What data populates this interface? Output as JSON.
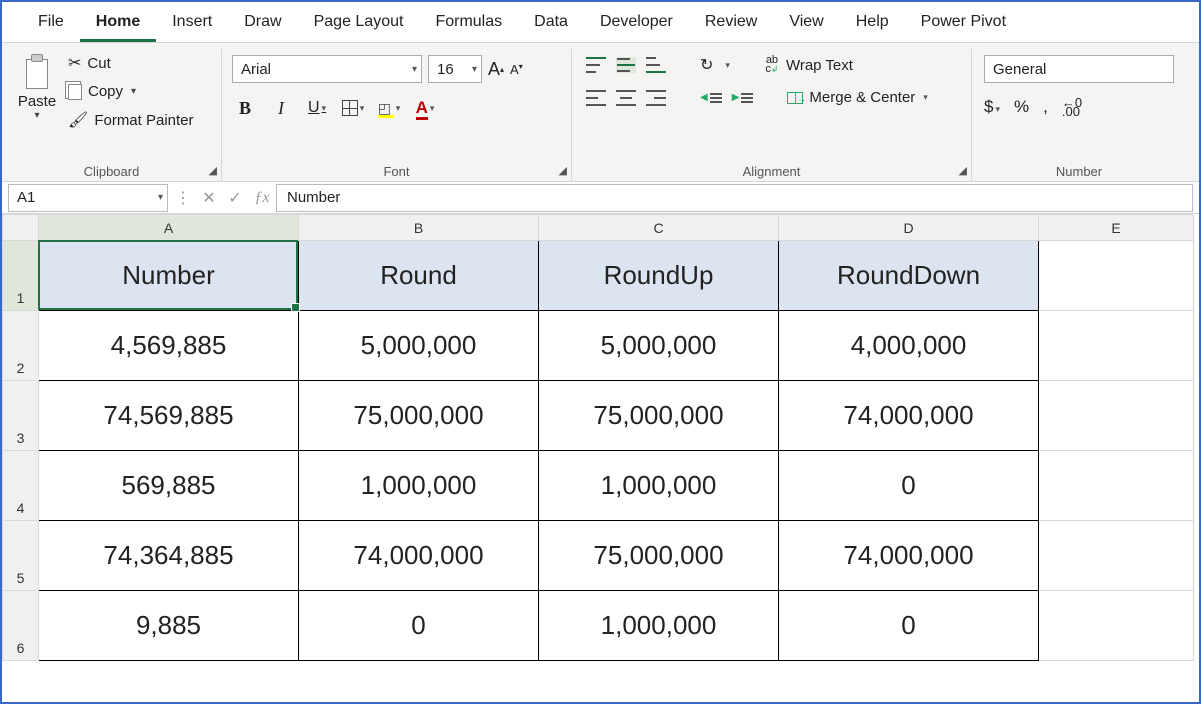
{
  "tabs": [
    "File",
    "Home",
    "Insert",
    "Draw",
    "Page Layout",
    "Formulas",
    "Data",
    "Developer",
    "Review",
    "View",
    "Help",
    "Power Pivot"
  ],
  "active_tab": "Home",
  "ribbon": {
    "clipboard": {
      "group_label": "Clipboard",
      "paste": "Paste",
      "cut": "Cut",
      "copy": "Copy",
      "format_painter": "Format Painter"
    },
    "font": {
      "group_label": "Font",
      "font_name": "Arial",
      "font_size": "16"
    },
    "alignment": {
      "group_label": "Alignment",
      "wrap_text": "Wrap Text",
      "merge_center": "Merge & Center"
    },
    "number": {
      "group_label": "Number",
      "format": "General"
    }
  },
  "namebox": "A1",
  "formula": "Number",
  "columns": [
    "A",
    "B",
    "C",
    "D",
    "E"
  ],
  "chart_data": {
    "type": "table",
    "headers": [
      "Number",
      "Round",
      "RoundUp",
      "RoundDown"
    ],
    "rows": [
      [
        "4,569,885",
        "5,000,000",
        "5,000,000",
        "4,000,000"
      ],
      [
        "74,569,885",
        "75,000,000",
        "75,000,000",
        "74,000,000"
      ],
      [
        "569,885",
        "1,000,000",
        "1,000,000",
        "0"
      ],
      [
        "74,364,885",
        "74,000,000",
        "75,000,000",
        "74,000,000"
      ],
      [
        "9,885",
        "0",
        "1,000,000",
        "0"
      ]
    ]
  }
}
